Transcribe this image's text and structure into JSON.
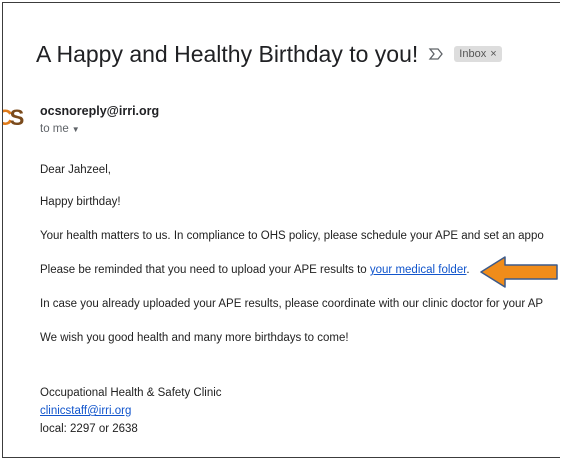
{
  "subject": "A Happy and Healthy Birthday to you!",
  "label_chip": {
    "text": "Inbox",
    "close": "×"
  },
  "avatar": {
    "first": "C",
    "second": "S"
  },
  "sender": "ocsnoreply@irri.org",
  "recipient": "to me",
  "body": {
    "greeting": "Dear Jahzeel,",
    "line2": "Happy birthday!",
    "line3": "Your health matters to us. In compliance to OHS policy, please schedule your APE and set an appo",
    "line4_prefix": "Please be reminded that you need to upload your APE results to ",
    "line4_link": "your medical folder",
    "line4_suffix": ".",
    "line5": "In case you already uploaded your APE results, please coordinate with our clinic doctor for your AP",
    "line6": "We wish you good health and many more birthdays to come!"
  },
  "signature": {
    "name": "Occupational Health & Safety Clinic",
    "email": "clinicstaff@irri.org",
    "local": "local: 2297 or 2638"
  },
  "colors": {
    "link": "#1155cc",
    "arrow_fill": "#f08c1a",
    "arrow_stroke": "#3c5a8a",
    "chip_bg": "#dddddd"
  }
}
